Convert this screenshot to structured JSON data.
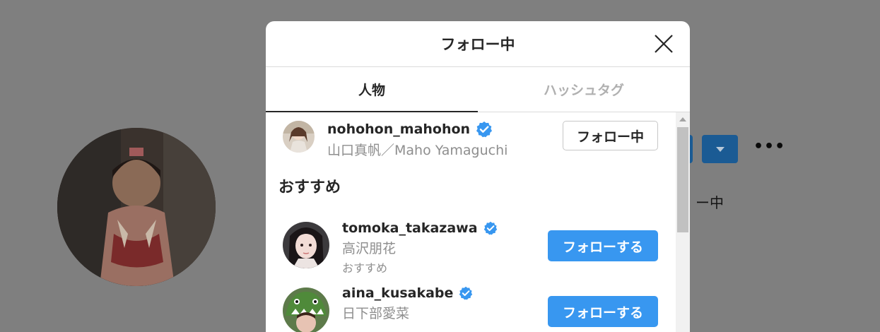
{
  "modal": {
    "title": "フォロー中",
    "tabs": [
      {
        "label": "人物",
        "active": true
      },
      {
        "label": "ハッシュタグ",
        "active": false
      }
    ]
  },
  "current_following": {
    "username": "nohohon_mahohon",
    "full_name": "山口真帆／Maho Yamaguchi",
    "verified": true,
    "button_label": "フォロー中"
  },
  "suggestions": {
    "title": "おすすめ",
    "items": [
      {
        "username": "tomoka_takazawa",
        "full_name": "高沢朋花",
        "subtext": "おすすめ",
        "verified": true,
        "button_label": "フォローする"
      },
      {
        "username": "aina_kusakabe",
        "full_name": "日下部愛菜",
        "subtext": "",
        "verified": true,
        "button_label": "フォローする"
      }
    ]
  },
  "background": {
    "partial_text": "ー中"
  },
  "colors": {
    "follow_button": "#3897f0",
    "verified_badge": "#3897f0",
    "overlay": "#7f7f7f"
  },
  "icons": [
    "close-icon",
    "verified-badge-icon",
    "chevron-down-icon",
    "more-options-icon",
    "scroll-up-arrow-icon"
  ]
}
